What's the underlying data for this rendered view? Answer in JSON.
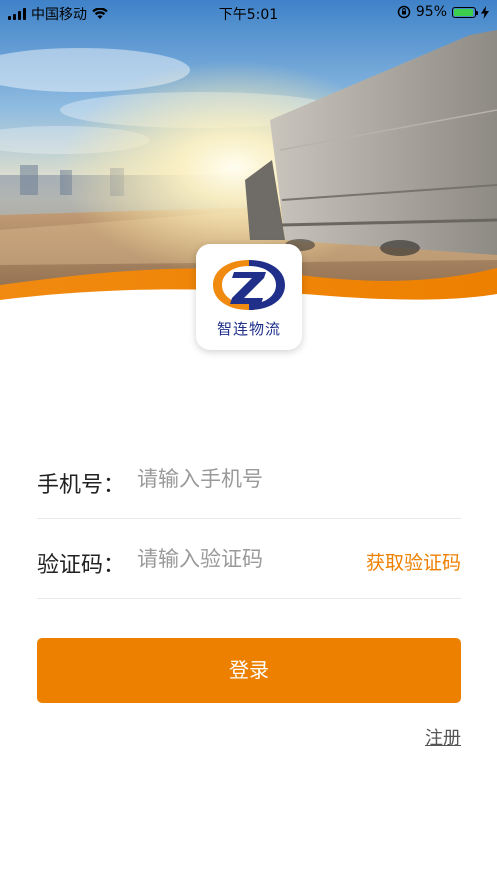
{
  "status_bar": {
    "carrier": "中国移动",
    "time": "下午5:01",
    "battery_percent": "95%",
    "battery_level": 0.95,
    "icons": [
      "signal-icon",
      "wifi-icon",
      "rotation-lock-icon",
      "battery-icon",
      "charging-icon"
    ]
  },
  "colors": {
    "accent": "#ee8000",
    "logo_blue": "#1f2f8a"
  },
  "logo": {
    "text": "智连物流",
    "icon": "logo-z-icon"
  },
  "form": {
    "phone_label": "手机号：",
    "phone_placeholder": "请输入手机号",
    "code_label": "验证码：",
    "code_placeholder": "请输入验证码",
    "get_code": "获取验证码"
  },
  "actions": {
    "login": "登录",
    "register": "注册"
  }
}
